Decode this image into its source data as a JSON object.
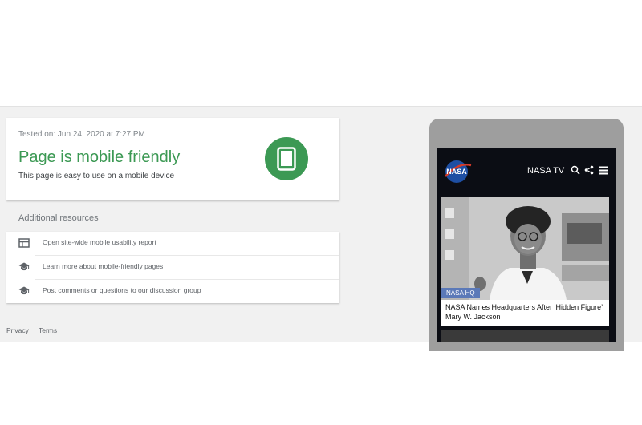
{
  "result": {
    "tested_on": "Tested on: Jun 24, 2020 at 7:27 PM",
    "title": "Page is mobile friendly",
    "subtitle": "This page is easy to use on a mobile device",
    "badge_icon": "smartphone-icon"
  },
  "resources": {
    "heading": "Additional resources",
    "items": [
      {
        "icon": "report-icon",
        "label": "Open site-wide mobile usability report"
      },
      {
        "icon": "school-icon",
        "label": "Learn more about mobile-friendly pages"
      },
      {
        "icon": "school-icon",
        "label": "Post comments or questions to our discussion group"
      }
    ]
  },
  "footer": {
    "privacy": "Privacy",
    "terms": "Terms"
  },
  "preview": {
    "logo_text": "NASA",
    "tv_label": "NASA TV",
    "toolbar_icons": [
      "search-icon",
      "share-icon",
      "menu-icon"
    ],
    "story": {
      "tag": "NASA HQ",
      "headline": "NASA Names Headquarters After ‘Hidden Figure’ Mary W. Jackson"
    }
  },
  "colors": {
    "success_green": "#3c9954",
    "nasa_blue": "#5b79b8",
    "band_background": "#f1f1f1"
  }
}
